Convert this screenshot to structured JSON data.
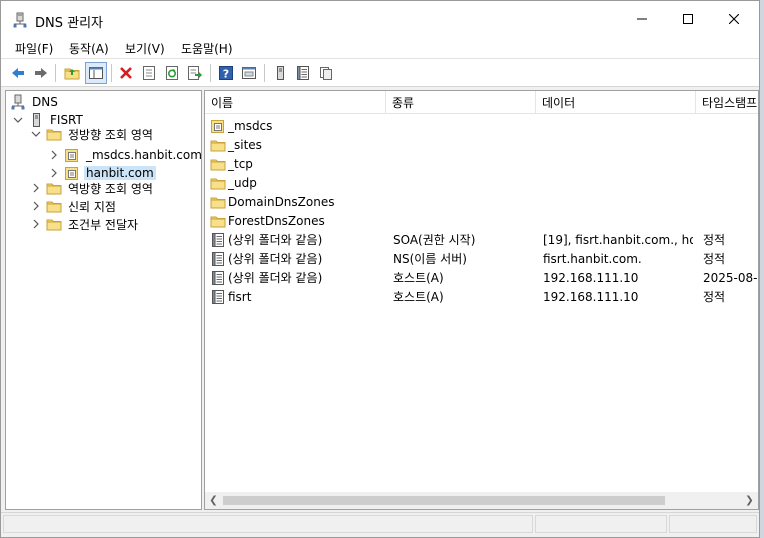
{
  "window": {
    "title": "DNS 관리자"
  },
  "menu": [
    "파일(F)",
    "동작(A)",
    "보기(V)",
    "도움말(H)"
  ],
  "toolbar": {
    "buttons": [
      "back",
      "forward",
      "up-folder",
      "show-hide-tree",
      "delete",
      "properties",
      "refresh",
      "export-list",
      "help",
      "view-pane",
      "server",
      "list",
      "details"
    ]
  },
  "tree": {
    "root": "DNS",
    "server": "FISRT",
    "forward_zones": "정방향 조회 영역",
    "zone_msdcs": "_msdcs.hanbit.com",
    "zone_hanbit": "hanbit.com",
    "reverse_zones": "역방향 조회 영역",
    "trust_points": "신뢰 지점",
    "conditional_forwarders": "조건부 전달자"
  },
  "list": {
    "columns": [
      "이름",
      "종류",
      "데이터",
      "타임스탬프"
    ],
    "rows": [
      {
        "name": "_msdcs",
        "type": "",
        "data": "",
        "timestamp": "",
        "icon": "zone-folder"
      },
      {
        "name": "_sites",
        "type": "",
        "data": "",
        "timestamp": "",
        "icon": "folder"
      },
      {
        "name": "_tcp",
        "type": "",
        "data": "",
        "timestamp": "",
        "icon": "folder"
      },
      {
        "name": "_udp",
        "type": "",
        "data": "",
        "timestamp": "",
        "icon": "folder"
      },
      {
        "name": "DomainDnsZones",
        "type": "",
        "data": "",
        "timestamp": "",
        "icon": "folder"
      },
      {
        "name": "ForestDnsZones",
        "type": "",
        "data": "",
        "timestamp": "",
        "icon": "folder"
      },
      {
        "name": "(상위 폴더와 같음)",
        "type": "SOA(권한 시작)",
        "data": "[19], fisrt.hanbit.com., ho...",
        "timestamp": "정적",
        "icon": "record"
      },
      {
        "name": "(상위 폴더와 같음)",
        "type": "NS(이름 서버)",
        "data": "fisrt.hanbit.com.",
        "timestamp": "정적",
        "icon": "record"
      },
      {
        "name": "(상위 폴더와 같음)",
        "type": "호스트(A)",
        "data": "192.168.111.10",
        "timestamp": "2025-08-",
        "icon": "record"
      },
      {
        "name": "fisrt",
        "type": "호스트(A)",
        "data": "192.168.111.10",
        "timestamp": "정적",
        "icon": "record"
      }
    ]
  },
  "colors": {
    "folder": "#f4d36a",
    "folder_edge": "#c9a23a",
    "selection": "#cce4f7",
    "toolbar_active": "#dcebfc"
  }
}
